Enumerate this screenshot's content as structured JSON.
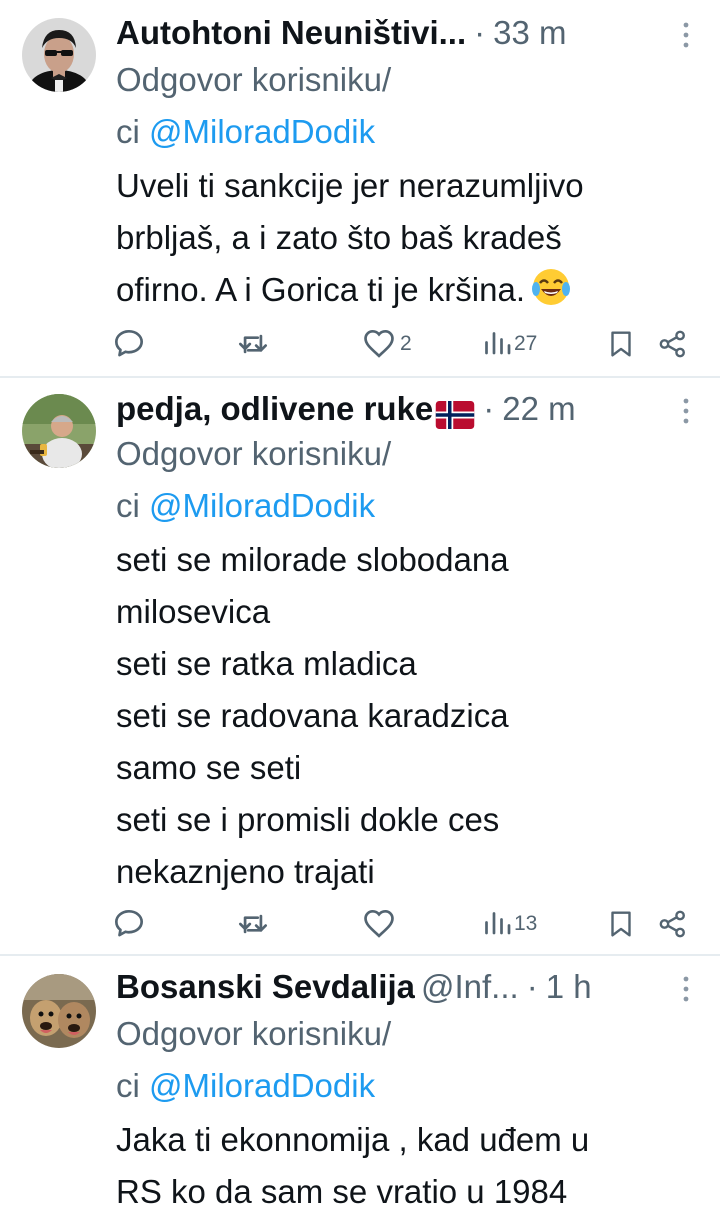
{
  "tweets": [
    {
      "name": "Autohtoni Neuništivi...",
      "handle": "",
      "dot": "·",
      "time": "33 m",
      "reply_prefix": "Odgovor korisniku/",
      "reply_cont": "ci",
      "reply_mention": "@MiloradDodik",
      "body": "Uveli ti sankcije jer nerazumljivo\nbrbljaš, a i zato što baš kradeš\nofirno. A i Gorica ti je kršina.",
      "emoji": "face-with-tears-of-joy",
      "likes": "2",
      "views": "27"
    },
    {
      "name": "pedja, odlivene ruke",
      "flag": "norway-flag",
      "dot": "·",
      "time": "22 m",
      "reply_prefix": "Odgovor korisniku/",
      "reply_cont": "ci",
      "reply_mention": "@MiloradDodik",
      "body": "seti se milorade slobodana\nmilosevica\nseti se ratka mladica\nseti se radovana karadzica\nsamo se seti\nseti se i promisli dokle ces\nnekaznjeno trajati",
      "likes": "",
      "views": "13"
    },
    {
      "name": "Bosanski Sevdalija",
      "handle": "@Inf...",
      "dot": "·",
      "time": "1 h",
      "reply_prefix": "Odgovor korisniku/",
      "reply_cont": "ci",
      "reply_mention": "@MiloradDodik",
      "body": "Jaka ti ekonnomija , kad uđem u\nRS ko da sam se vratio u 1984"
    }
  ],
  "colors": {
    "text": "#0f1419",
    "secondary": "#536471",
    "link": "#1d9bf0",
    "divider": "#e6ecf0"
  },
  "icons": [
    "reply-icon",
    "retweet-icon",
    "like-icon",
    "views-icon",
    "bookmark-icon",
    "share-icon",
    "more-icon"
  ]
}
